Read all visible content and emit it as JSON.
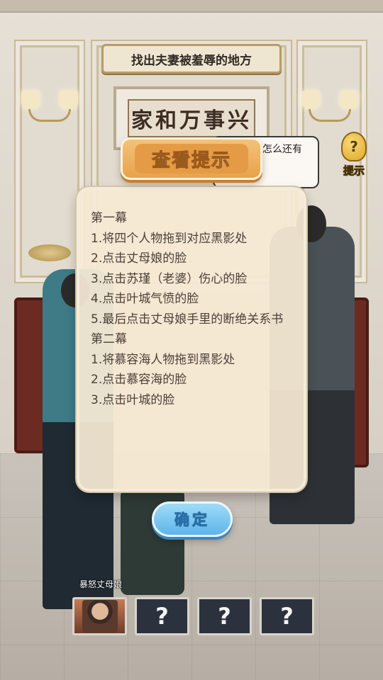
{
  "scene": {
    "plaque_text": "家和万事兴",
    "speech_text": "的婚约，怎么还有闹到家！"
  },
  "header": {
    "level_title": "找出夫妻被羞辱的地方"
  },
  "hint_button": {
    "icon": "?",
    "label": "提示"
  },
  "modal": {
    "title": "查看提示",
    "lines": [
      "第一幕",
      "1.将四个人物拖到对应黑影处",
      "2.点击丈母娘的脸",
      "3.点击苏瑾（老婆）伤心的脸",
      "4.点击叶城气愤的脸",
      "5.最后点击丈母娘手里的断绝关系书",
      "第二幕",
      "1.将慕容海人物拖到黑影处",
      "2.点击慕容海的脸",
      "3.点击叶城的脸"
    ],
    "confirm_label": "确定"
  },
  "slots": {
    "caption": "暴怒丈母娘",
    "items": [
      {
        "state": "filled",
        "label": ""
      },
      {
        "state": "locked",
        "label": "?"
      },
      {
        "state": "locked",
        "label": "?"
      },
      {
        "state": "locked",
        "label": "?"
      }
    ]
  },
  "colors": {
    "header_orange": "#e9a24a",
    "confirm_blue": "#5eb4ea",
    "modal_paper": "#f6ead4",
    "slot_dark": "#2c323d"
  }
}
